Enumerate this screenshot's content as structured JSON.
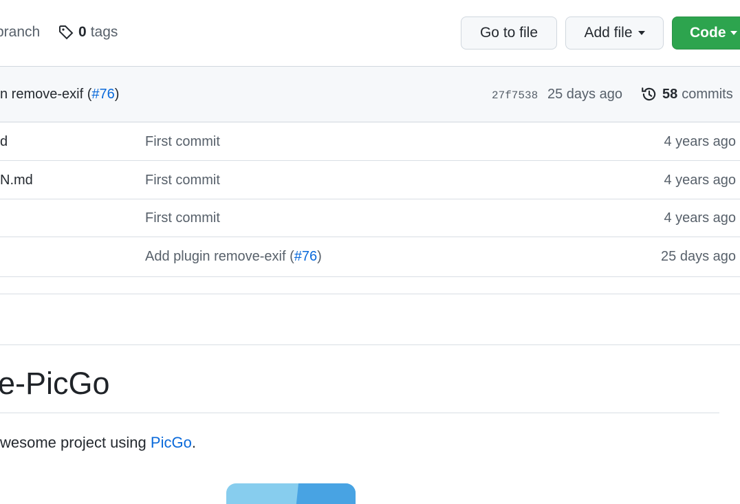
{
  "nav": {
    "branch_text": "branch",
    "tags_count": "0",
    "tags_text": "tags"
  },
  "buttons": {
    "go_to_file": "Go to file",
    "add_file": "Add file",
    "code": "Code"
  },
  "latest_commit": {
    "message_prefix": "n remove-exif (",
    "pr_link": "#76",
    "message_suffix": ")",
    "sha": "27f7538",
    "age": "25 days ago",
    "commits_count": "58",
    "commits_label": "commits"
  },
  "files": [
    {
      "name": "d",
      "commit_message": "First commit",
      "age": "4 years ago"
    },
    {
      "name": "N.md",
      "commit_message": "First commit",
      "age": "4 years ago"
    },
    {
      "name": "",
      "commit_message": "First commit",
      "age": "4 years ago"
    },
    {
      "name": "",
      "commit_prefix": "Add plugin remove-exif (",
      "commit_link": "#76",
      "commit_suffix": ")",
      "age": "25 days ago"
    }
  ],
  "readme": {
    "heading": "e-PicGo",
    "text_prefix": "wesome project using ",
    "text_link": "PicGo",
    "text_suffix": "."
  },
  "colors": {
    "accent_link": "#0969da",
    "code_button": "#2da44e",
    "commit_bar_bg": "#f6f8fa",
    "logo_light": "#87cdee",
    "logo_dark": "#48a3e3"
  },
  "icons": {
    "tag": "tag-icon",
    "history": "history-icon",
    "caret": "caret-down-icon"
  }
}
